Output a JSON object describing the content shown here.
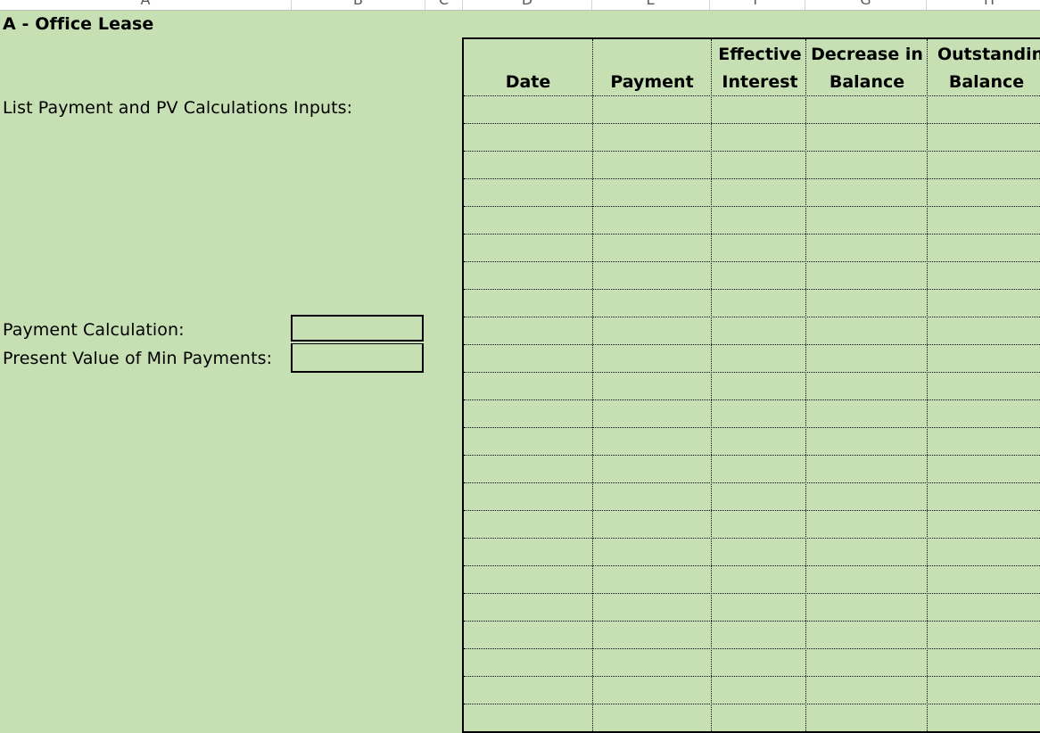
{
  "spreadsheet": {
    "column_letters": [
      "A",
      "B",
      "C",
      "D",
      "E",
      "F",
      "G",
      "H"
    ],
    "title": "A - Office Lease",
    "inputs_label": "List Payment and PV Calculations Inputs:",
    "payment_calc_label": "Payment Calculation:",
    "pv_label": "Present Value of Min Payments:",
    "payment_calc_value": "",
    "pv_value": ""
  },
  "amortization_table": {
    "headers": [
      {
        "line1": "",
        "line2": "Date"
      },
      {
        "line1": "",
        "line2": "Payment"
      },
      {
        "line1": "Effective",
        "line2": "Interest"
      },
      {
        "line1": "Decrease in",
        "line2": "Balance"
      },
      {
        "line1": "Outstanding",
        "line2": "Balance"
      }
    ],
    "row_count": 23
  },
  "colors": {
    "sheet_fill": "#c6e0b4",
    "border": "#000000"
  }
}
